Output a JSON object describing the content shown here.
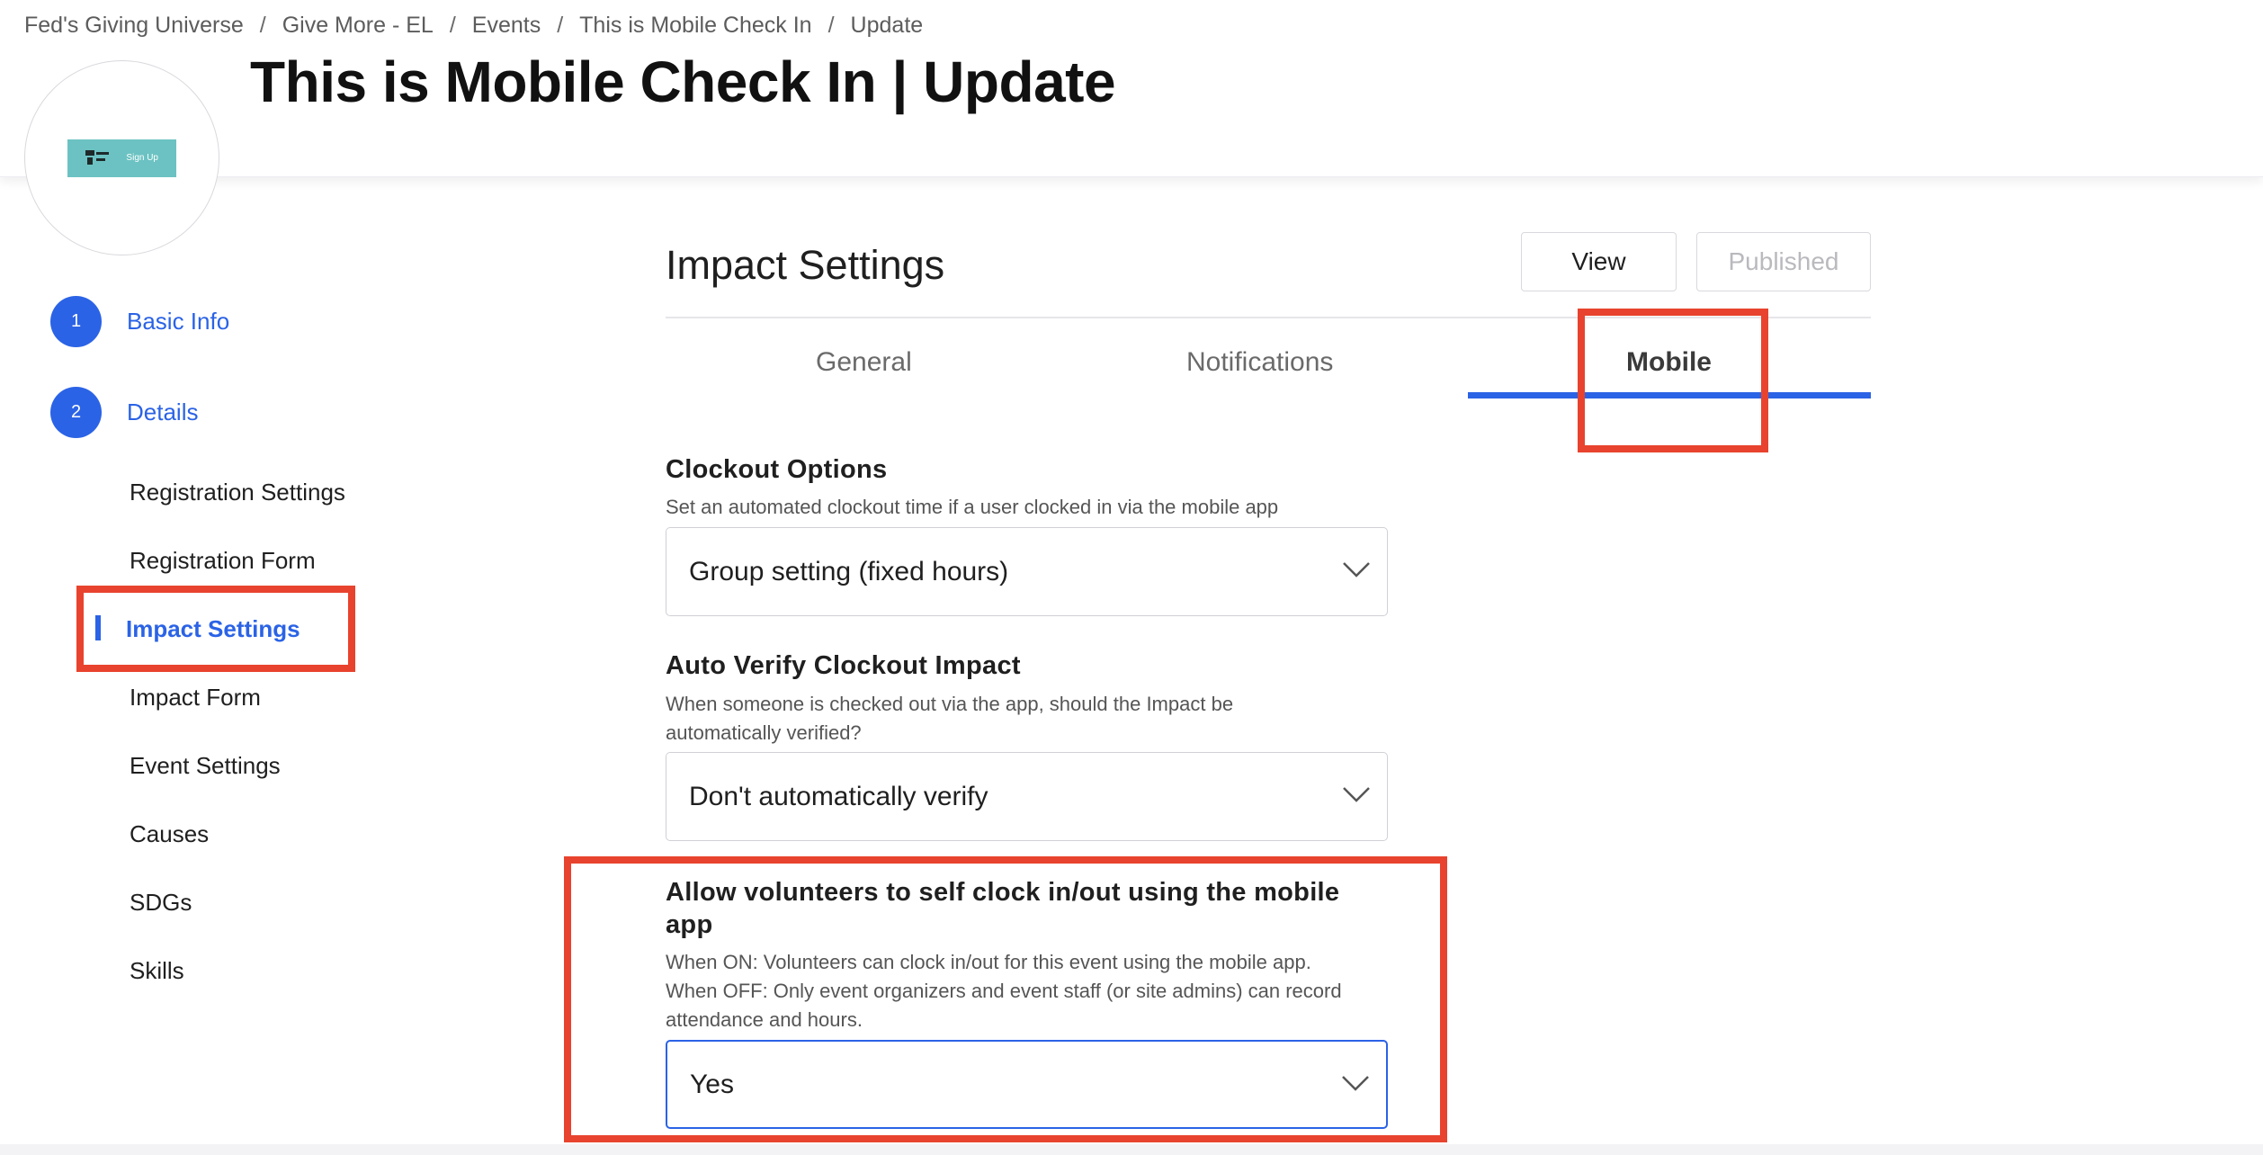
{
  "breadcrumb": {
    "items": [
      "Fed's Giving Universe",
      "Give More - EL",
      "Events",
      "This is Mobile Check In",
      "Update"
    ],
    "separator": "/"
  },
  "header": {
    "title": "This is Mobile Check In | Update",
    "logo_text": "Sign Up"
  },
  "sidebar": {
    "steps": [
      {
        "number": "1",
        "label": "Basic Info"
      },
      {
        "number": "2",
        "label": "Details"
      }
    ],
    "items": [
      "Registration Settings",
      "Registration Form",
      "Impact Settings",
      "Impact Form",
      "Event Settings",
      "Causes",
      "SDGs",
      "Skills"
    ],
    "active_item": "Impact Settings"
  },
  "main": {
    "title": "Impact Settings",
    "view_label": "View",
    "published_label": "Published",
    "tabs": [
      "General",
      "Notifications",
      "Mobile"
    ],
    "active_tab": "Mobile",
    "fields": [
      {
        "title": "Clockout Options",
        "description": "Set an automated clockout time if a user clocked in via the mobile app",
        "value": "Group setting (fixed hours)"
      },
      {
        "title": "Auto Verify Clockout Impact",
        "description_lines": [
          "When someone is checked out via the app, should the Impact be",
          "automatically verified?"
        ],
        "value": "Don't automatically verify"
      },
      {
        "title_lines": [
          "Allow volunteers to self clock in/out using the mobile",
          "app"
        ],
        "description_lines": [
          "When ON: Volunteers can clock in/out for this event using the mobile app.",
          "When OFF: Only event organizers and event staff (or site admins) can record",
          "attendance and hours."
        ],
        "value": "Yes"
      }
    ]
  },
  "colors": {
    "accent": "#2b63e6",
    "highlight": "#e8432e",
    "logo_bg": "#6cc2c2"
  },
  "icons": [
    "chevron-down-icon",
    "logo-mark-icon"
  ]
}
